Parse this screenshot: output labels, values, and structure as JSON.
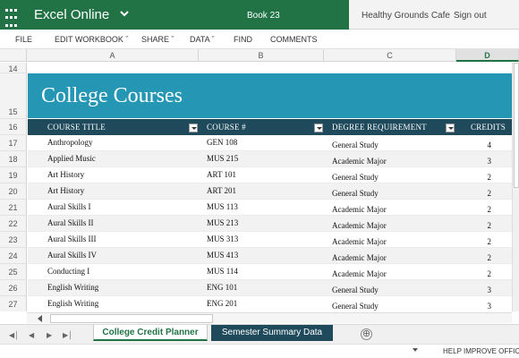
{
  "titlebar": {
    "app_name": "Excel Online",
    "book_name": "Book 23",
    "user_org": "Healthy Grounds Cafe",
    "sign_out": "Sign out",
    "icons": [
      "app-launcher-icon",
      "chevron-down-icon"
    ],
    "accent_color": "#217346"
  },
  "menu": [
    "FILE",
    "EDIT WORKBOOK ˇ",
    "SHARE ˇ",
    "DATA ˇ",
    "FIND",
    "COMMENTS"
  ],
  "column_headers": [
    "A",
    "B",
    "C",
    "D"
  ],
  "selected_column": "D",
  "row_numbers": [
    "14",
    "15",
    "16",
    "17",
    "18",
    "19",
    "20",
    "21",
    "22",
    "23",
    "24",
    "25",
    "26",
    "27"
  ],
  "sheet": {
    "title": "College Courses",
    "banner_color": "#2596b4",
    "header_color": "#1e4a5c",
    "headers": [
      "COURSE TITLE",
      "COURSE #",
      "DEGREE REQUIREMENT",
      "CREDITS"
    ],
    "rows": [
      [
        "Anthropology",
        "GEN 108",
        "General Study",
        "4"
      ],
      [
        "Applied Music",
        "MUS 215",
        "Academic Major",
        "3"
      ],
      [
        "Art History",
        "ART 101",
        "General Study",
        "2"
      ],
      [
        "Art History",
        "ART 201",
        "General Study",
        "2"
      ],
      [
        "Aural Skills I",
        "MUS 113",
        "Academic Major",
        "2"
      ],
      [
        "Aural Skills II",
        "MUS 213",
        "Academic Major",
        "2"
      ],
      [
        "Aural Skills III",
        "MUS 313",
        "Academic Major",
        "2"
      ],
      [
        "Aural Skills IV",
        "MUS 413",
        "Academic Major",
        "2"
      ],
      [
        "Conducting I",
        "MUS 114",
        "Academic Major",
        "2"
      ],
      [
        "English Writing",
        "ENG 101",
        "General Study",
        "3"
      ],
      [
        "English Writing",
        "ENG 201",
        "General Study",
        "3"
      ]
    ]
  },
  "sheet_tabs": [
    "College Credit Planner",
    "Semester Summary Data"
  ],
  "active_tab": "College Credit Planner",
  "add_sheet_symbol": "⊕",
  "statusbar": {
    "help": "HELP IMPROVE OFFICE"
  }
}
